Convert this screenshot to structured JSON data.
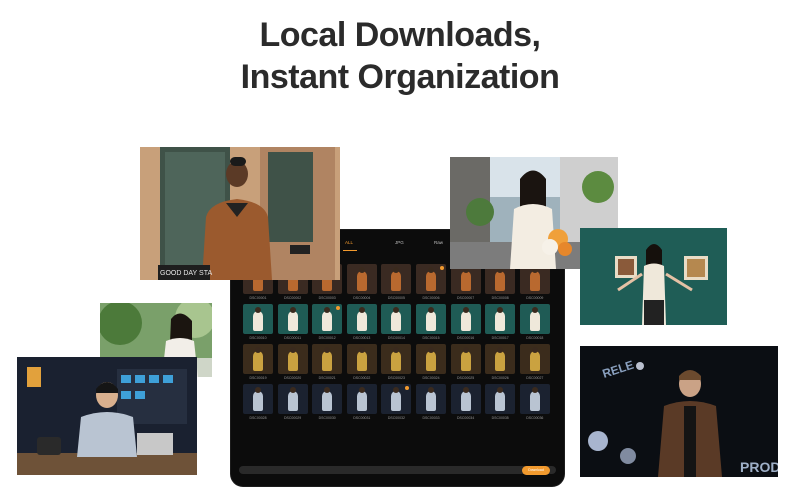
{
  "headline": {
    "line1": "Local Downloads,",
    "line2": "Instant Organization"
  },
  "tablet": {
    "tabs": [
      {
        "label": "ALL",
        "active": true
      },
      {
        "label": "JPG",
        "active": false
      },
      {
        "label": "Raw",
        "active": false
      }
    ],
    "rows": [
      [
        "DSC00001",
        "DSC00002",
        "DSC00003",
        "DSC00004",
        "DSC00005",
        "DSC00006",
        "DSC00007",
        "DSC00008",
        "DSC00009"
      ],
      [
        "DSC00010",
        "DSC00011",
        "DSC00012",
        "DSC00013",
        "DSC00014",
        "DSC00015",
        "DSC00016",
        "DSC00017",
        "DSC00018"
      ],
      [
        "DSC00019",
        "DSC00020",
        "DSC00021",
        "DSC00022",
        "DSC00023",
        "DSC00024",
        "DSC00025",
        "DSC00026",
        "DSC00027"
      ],
      [
        "DSC00028",
        "DSC00029",
        "DSC00030",
        "DSC00031",
        "DSC00032",
        "DSC00033",
        "DSC00034",
        "DSC00035",
        "DSC00036"
      ]
    ],
    "download_label": "Download",
    "accent_color": "#f29a2e"
  },
  "photos": {
    "man_wall_sign": "GOOD DAY STA",
    "stage_sign_top": "RELE",
    "stage_sign_bottom": "PROD"
  }
}
